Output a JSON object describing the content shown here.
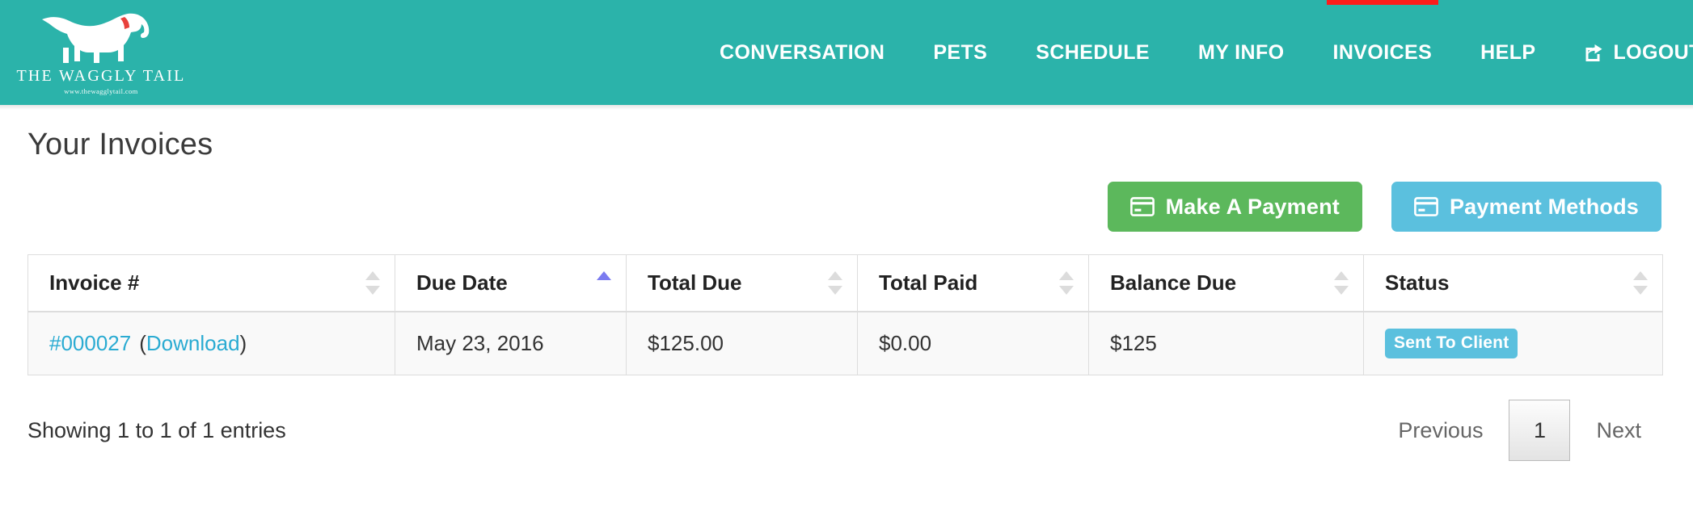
{
  "brand": {
    "name": "THE WAGGLY TAIL",
    "url": "www.thewagglytail.com",
    "logo_icon": "dog-icon",
    "background_color": "#2bb3aa"
  },
  "nav": {
    "active_indicator_color": "#fc1c1c",
    "items": [
      {
        "label": "CONVERSATION",
        "active": false
      },
      {
        "label": "PETS",
        "active": false
      },
      {
        "label": "SCHEDULE",
        "active": false
      },
      {
        "label": "MY INFO",
        "active": false
      },
      {
        "label": "INVOICES",
        "active": true
      },
      {
        "label": "HELP",
        "active": false
      },
      {
        "label": "LOGOUT",
        "active": false,
        "icon": "logout-icon"
      }
    ]
  },
  "page": {
    "title": "Your Invoices"
  },
  "actions": {
    "make_payment": {
      "label": "Make A Payment",
      "icon": "credit-card-icon",
      "color": "#5cb85c"
    },
    "payment_methods": {
      "label": "Payment Methods",
      "icon": "credit-card-icon",
      "color": "#5bc0de"
    }
  },
  "table": {
    "columns": [
      {
        "label": "Invoice #",
        "sort": "none"
      },
      {
        "label": "Due Date",
        "sort": "asc"
      },
      {
        "label": "Total Due",
        "sort": "none"
      },
      {
        "label": "Total Paid",
        "sort": "none"
      },
      {
        "label": "Balance Due",
        "sort": "none"
      },
      {
        "label": "Status",
        "sort": "none"
      }
    ],
    "rows": [
      {
        "invoice_number": "#000027",
        "download_label": "Download",
        "paren_open": "(",
        "paren_close": ")",
        "due_date": "May 23, 2016",
        "total_due": "$125.00",
        "total_paid": "$0.00",
        "balance_due": "$125",
        "status": "Sent To Client",
        "status_color": "#5bc0de"
      }
    ]
  },
  "footer": {
    "showing_info": "Showing 1 to 1 of 1 entries",
    "pagination": {
      "previous": "Previous",
      "current_page": "1",
      "next": "Next"
    }
  }
}
